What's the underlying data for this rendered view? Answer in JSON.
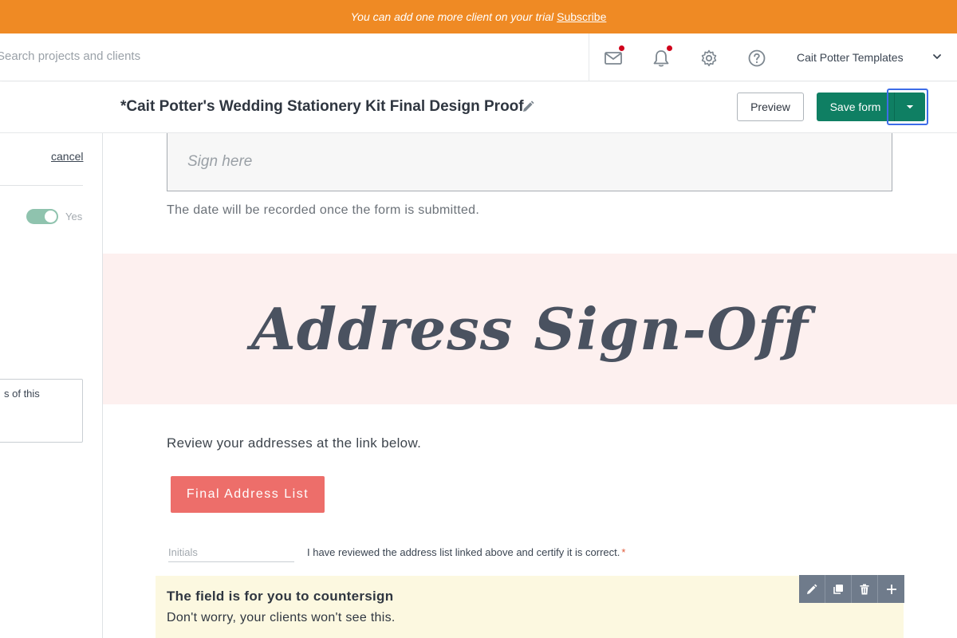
{
  "banner": {
    "message": "You can add one more client on your trial",
    "link": "Subscribe"
  },
  "topnav": {
    "search_placeholder": "Search projects and clients",
    "account_name": "Cait Potter Templates",
    "icons": [
      "mail-icon",
      "bell-icon",
      "gear-icon",
      "help-icon",
      "chevron-down-icon"
    ],
    "notification_color": "#d0021b"
  },
  "formbar": {
    "title": "*Cait Potter's Wedding Stationery Kit Final Design Proof",
    "preview_label": "Preview",
    "save_label": "Save form"
  },
  "leftpanel": {
    "cancel_label": "cancel",
    "toggle_label": "Yes",
    "toggle_on": true,
    "textarea_value": "s of this"
  },
  "main": {
    "signature_placeholder": "Sign here",
    "date_note": "The date will be recorded once the form is submitted.",
    "hero_title": "Address Sign-Off",
    "review_text": "Review your addresses at the link below.",
    "address_button": "Final Address List",
    "initials_placeholder": "Initials",
    "certify_text": "I have reviewed the address list linked above and certify it is correct.",
    "required_mark": "*",
    "countersign_line1": "The field is for you to countersign",
    "countersign_line2": "Don't worry, your clients won't see this."
  },
  "colors": {
    "banner": "#ef8a24",
    "primary": "#0f7f63",
    "hero_bg": "#fdf0ef",
    "accent_button": "#ed6e6a",
    "countersign_bg": "#fcf8e0",
    "toolbar": "#6f7b8b",
    "focus_ring": "#3d6ce8"
  }
}
